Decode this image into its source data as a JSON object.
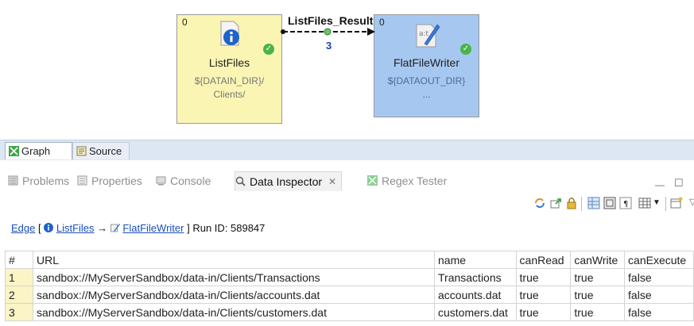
{
  "graph": {
    "nodes": [
      {
        "id": "list",
        "title": "ListFiles",
        "sub": [
          "${DATAIN_DIR}/",
          "Clients/"
        ],
        "port": "0"
      },
      {
        "id": "writer",
        "title": "FlatFileWriter",
        "sub": [
          "${DATAOUT_DIR}",
          "..."
        ],
        "port": "0"
      }
    ],
    "edge": {
      "label": "ListFiles_Result",
      "count": "3"
    }
  },
  "editor_tabs": [
    {
      "label": "Graph",
      "icon": "graph-icon",
      "active": true
    },
    {
      "label": "Source",
      "icon": "source-icon",
      "active": false
    }
  ],
  "view_tabs": [
    {
      "label": "Problems",
      "icon": "problems-icon"
    },
    {
      "label": "Properties",
      "icon": "properties-icon"
    },
    {
      "label": "Console",
      "icon": "console-icon"
    },
    {
      "label": "Data Inspector",
      "icon": "magnifier-icon",
      "active": true
    },
    {
      "label": "Regex Tester",
      "icon": "regex-icon"
    }
  ],
  "inspector": {
    "edge_word": "Edge",
    "from": "ListFiles",
    "arrow": "→",
    "to": "FlatFileWriter",
    "run_label": "Run ID: 589847",
    "columns": [
      "#",
      "URL",
      "name",
      "canRead",
      "canWrite",
      "canExecute"
    ],
    "rows": [
      [
        "1",
        "sandbox://MyServerSandbox/data-in/Clients/Transactions",
        "Transactions",
        "true",
        "true",
        "false"
      ],
      [
        "2",
        "sandbox://MyServerSandbox/data-in/Clients/accounts.dat",
        "accounts.dat",
        "true",
        "true",
        "false"
      ],
      [
        "3",
        "sandbox://MyServerSandbox/data-in/Clients/customers.dat",
        "customers.dat",
        "true",
        "true",
        "false"
      ]
    ]
  },
  "colors": {
    "reader_bg": "#fbf5b4",
    "writer_bg": "#a6c8f0",
    "link": "#1b4fb8",
    "edge_count": "#1a3fb0"
  }
}
